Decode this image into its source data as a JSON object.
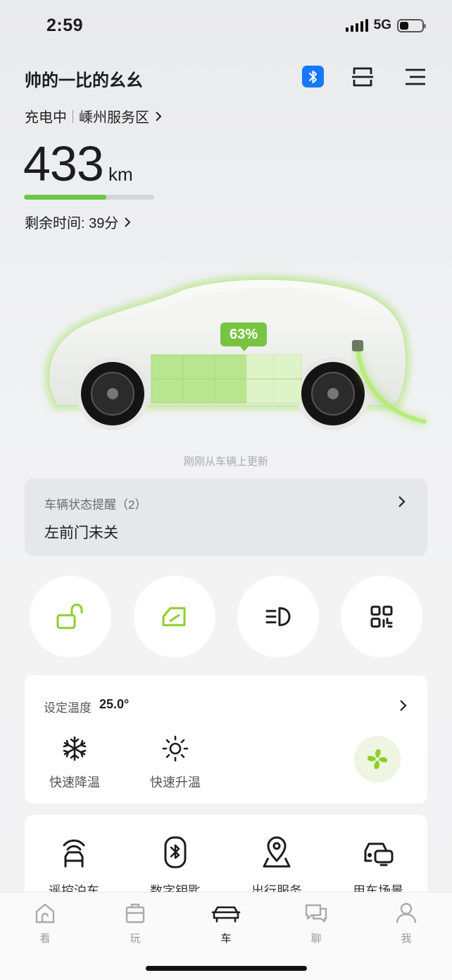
{
  "status_bar": {
    "time": "2:59",
    "network": "5G",
    "battery_level": 0.4
  },
  "header": {
    "owner_name": "帅的一比的幺幺",
    "charge_status": "充电中",
    "location": "嵊州服务区",
    "range_value": "433",
    "range_unit": "km",
    "range_fraction": 0.63,
    "time_remaining": "剩余时间: 39分"
  },
  "car": {
    "soc_label": "63%",
    "soc_fraction": 0.63,
    "updated_text": "刚刚从车辆上更新"
  },
  "reminder": {
    "title": "车辆状态提醒（2）",
    "text": "左前门未关"
  },
  "quick_controls": [
    {
      "name": "unlock-button",
      "icon": "unlock-icon"
    },
    {
      "name": "trunk-button",
      "icon": "trunk-icon"
    },
    {
      "name": "headlight-button",
      "icon": "headlight-icon"
    },
    {
      "name": "more-apps-button",
      "icon": "grid-icon"
    }
  ],
  "climate": {
    "label": "设定温度",
    "temperature": "25.0°",
    "cool_label": "快速降温",
    "heat_label": "快速升温"
  },
  "services": [
    {
      "label": "遥控泊车",
      "icon": "remote-parking-icon"
    },
    {
      "label": "数字钥匙",
      "icon": "digital-key-icon"
    },
    {
      "label": "出行服务",
      "icon": "location-pin-icon"
    },
    {
      "label": "用车场景",
      "icon": "car-scene-icon"
    }
  ],
  "tabs": [
    {
      "label": "看",
      "icon": "home-icon"
    },
    {
      "label": "玩",
      "icon": "bag-icon"
    },
    {
      "label": "车",
      "icon": "car-icon",
      "active": true
    },
    {
      "label": "聊",
      "icon": "chat-icon"
    },
    {
      "label": "我",
      "icon": "profile-icon"
    }
  ],
  "colors": {
    "accent_green": "#76c442",
    "brand_blue": "#1677ff",
    "icon_green": "#8ccf2a"
  }
}
